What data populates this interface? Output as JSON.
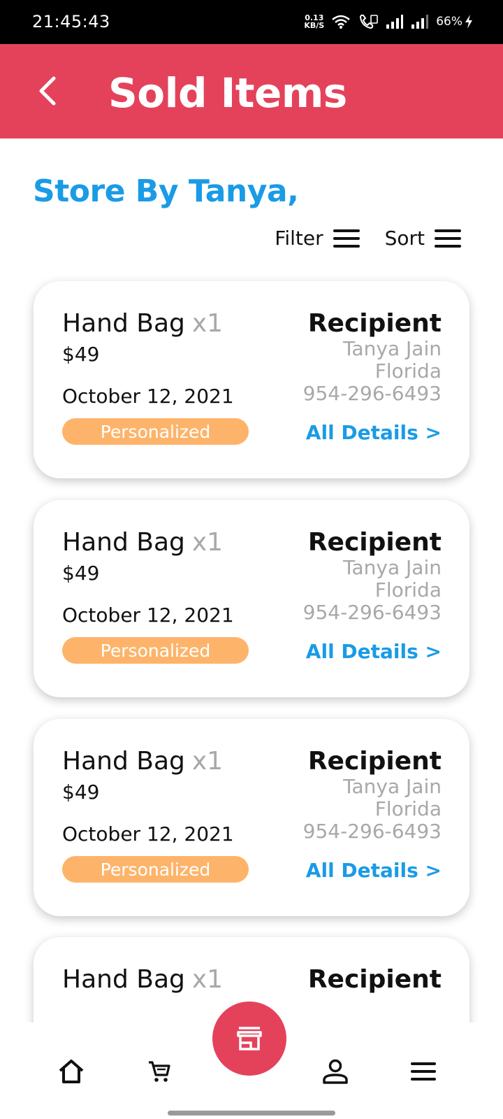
{
  "status_bar": {
    "time": "21:45:43",
    "net_speed_value": "0.13",
    "net_speed_unit": "KB/S",
    "battery": "66%",
    "icons": [
      "wifi-icon",
      "volte-icon",
      "signal-icon",
      "signal-icon",
      "charging-icon"
    ]
  },
  "app_bar": {
    "title": "Sold Items",
    "back_icon": "chevron-left-icon"
  },
  "store": {
    "title": "Store By Tanya,"
  },
  "toolbar": {
    "filter_label": "Filter",
    "sort_label": "Sort"
  },
  "items": [
    {
      "name": "Hand Bag",
      "qty": "x1",
      "price": "$49",
      "date": "October 12, 2021",
      "badge": "Personalized",
      "recipient_title": "Recipient",
      "recipient_name": "Tanya Jain",
      "recipient_location": "Florida",
      "recipient_phone": "954-296-6493",
      "details_link": "All Details >"
    },
    {
      "name": "Hand Bag",
      "qty": "x1",
      "price": "$49",
      "date": "October 12, 2021",
      "badge": "Personalized",
      "recipient_title": "Recipient",
      "recipient_name": "Tanya Jain",
      "recipient_location": "Florida",
      "recipient_phone": "954-296-6493",
      "details_link": "All Details >"
    },
    {
      "name": "Hand Bag",
      "qty": "x1",
      "price": "$49",
      "date": "October 12, 2021",
      "badge": "Personalized",
      "recipient_title": "Recipient",
      "recipient_name": "Tanya Jain",
      "recipient_location": "Florida",
      "recipient_phone": "954-296-6493",
      "details_link": "All Details >"
    },
    {
      "name": "Hand Bag",
      "qty": "x1",
      "recipient_title": "Recipient"
    }
  ],
  "bottom_nav": {
    "items": [
      "home-icon",
      "cart-icon",
      "store-icon",
      "profile-icon",
      "menu-icon"
    ],
    "active": "store-icon"
  },
  "colors": {
    "brand": "#E4425B",
    "accent": "#1A9BE6",
    "badge": "#FDB46A",
    "muted_text": "#A8A8A8"
  }
}
